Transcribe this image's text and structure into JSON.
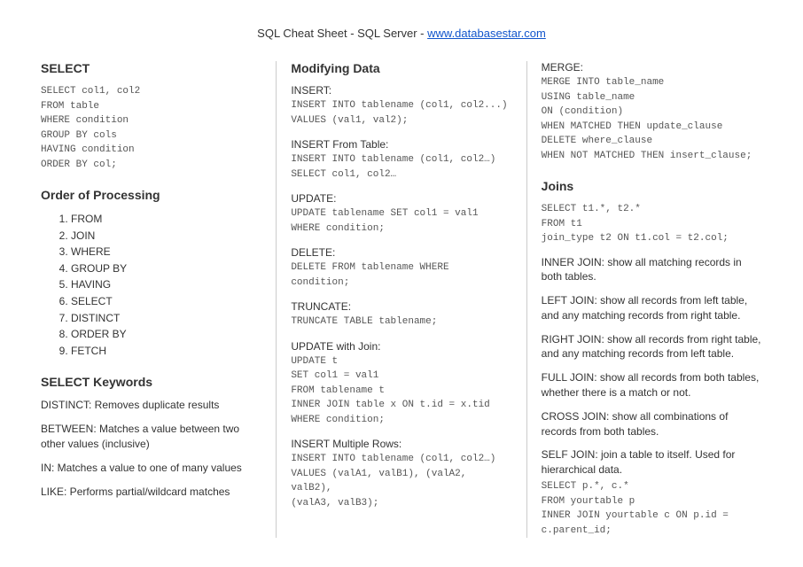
{
  "header": {
    "title_prefix": "SQL Cheat Sheet - SQL Server - ",
    "link_text": "www.databasestar.com"
  },
  "col1": {
    "select_heading": "SELECT",
    "select_code": "SELECT col1, col2\nFROM table\nWHERE condition\nGROUP BY cols\nHAVING condition\nORDER BY col;",
    "order_heading": "Order of Processing",
    "order_items": [
      "FROM",
      "JOIN",
      "WHERE",
      "GROUP BY",
      "HAVING",
      "SELECT",
      "DISTINCT",
      "ORDER BY",
      "FETCH"
    ],
    "keywords_heading": "SELECT Keywords",
    "kw_distinct": "DISTINCT: Removes duplicate results",
    "kw_between": "BETWEEN: Matches a value between two other values (inclusive)",
    "kw_in": "IN: Matches a value to one of many values",
    "kw_like": "LIKE: Performs partial/wildcard matches"
  },
  "col2": {
    "heading": "Modifying Data",
    "insert_label": "INSERT:",
    "insert_code": "INSERT INTO tablename (col1, col2...)\nVALUES (val1, val2);",
    "insert_from_label": "INSERT From Table:",
    "insert_from_code": "INSERT INTO tablename (col1, col2…)\nSELECT col1, col2…",
    "update_label": "UPDATE:",
    "update_code": "UPDATE tablename SET col1 = val1\nWHERE condition;",
    "delete_label": "DELETE:",
    "delete_code": "DELETE FROM tablename WHERE condition;",
    "truncate_label": "TRUNCATE:",
    "truncate_code": "TRUNCATE TABLE tablename;",
    "update_join_label": "UPDATE with Join:",
    "update_join_code": "UPDATE t\nSET col1 = val1\nFROM tablename t\nINNER JOIN table x ON t.id = x.tid\nWHERE condition;",
    "insert_multi_label": "INSERT Multiple Rows:",
    "insert_multi_code": "INSERT INTO tablename (col1, col2…)\nVALUES (valA1, valB1), (valA2, valB2),\n(valA3, valB3);"
  },
  "col3": {
    "merge_label": "MERGE:",
    "merge_code": "MERGE INTO table_name\nUSING table_name\nON (condition)\nWHEN MATCHED THEN update_clause\nDELETE where_clause\nWHEN NOT MATCHED THEN insert_clause;",
    "joins_heading": "Joins",
    "joins_code": "SELECT t1.*, t2.*\nFROM t1\njoin_type t2 ON t1.col = t2.col;",
    "inner": "INNER JOIN: show all matching records in both tables.",
    "left": "LEFT JOIN: show all records from left table, and any matching records from right table.",
    "right": "RIGHT JOIN: show all records from right table, and any matching records from left table.",
    "full": "FULL JOIN: show all records from both tables, whether there is a match or not.",
    "cross": "CROSS JOIN: show all combinations of records from both tables.",
    "self": "SELF JOIN: join a table to itself. Used for hierarchical data.",
    "self_code": "SELECT p.*, c.*\nFROM yourtable p\nINNER JOIN yourtable c ON p.id = c.parent_id;"
  }
}
